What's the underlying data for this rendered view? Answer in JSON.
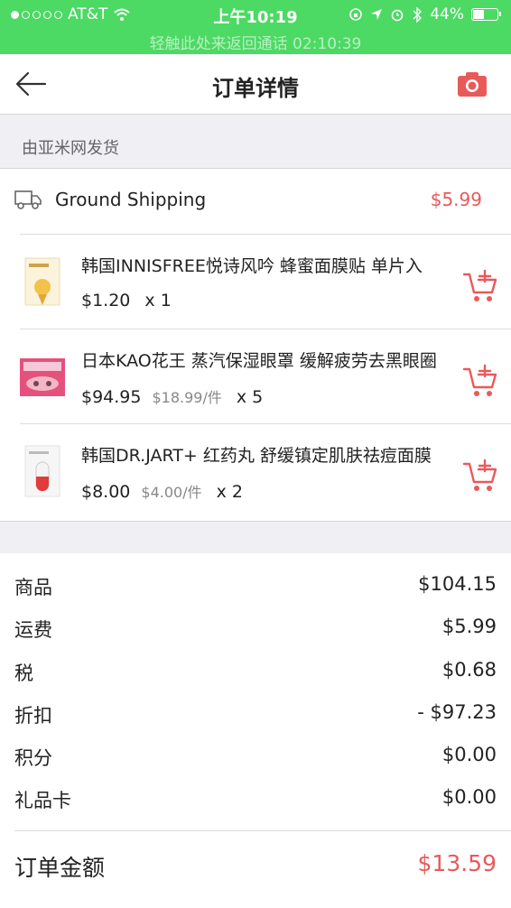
{
  "status_bar": {
    "carrier": "AT&T",
    "time": "上午10:19",
    "battery": "44%",
    "battery_level": 0.44,
    "callback": "轻触此处来返回通话 02:10:39"
  },
  "nav": {
    "title": "订单详情"
  },
  "shipper": "由亚米网发货",
  "shipping": {
    "method": "Ground Shipping",
    "price": "$5.99"
  },
  "items": [
    {
      "name": "韩国INNISFREE悦诗风吟 蜂蜜面膜贴 单片入",
      "price": "$1.20",
      "unit_price": "",
      "qty": "x 1"
    },
    {
      "name": "日本KAO花王 蒸汽保湿眼罩 缓解疲劳去黑眼圈",
      "price": "$94.95",
      "unit_price": "$18.99/件",
      "qty": "x 5"
    },
    {
      "name": "韩国DR.JART+ 红药丸 舒缓镇定肌肤祛痘面膜",
      "price": "$8.00",
      "unit_price": "$4.00/件",
      "qty": "x 2"
    }
  ],
  "summary": {
    "rows": [
      {
        "label": "商品",
        "value": "$104.15"
      },
      {
        "label": "运费",
        "value": "$5.99"
      },
      {
        "label": "税",
        "value": "$0.68"
      },
      {
        "label": "折扣",
        "value": "- $97.23"
      },
      {
        "label": "积分",
        "value": "$0.00"
      },
      {
        "label": "礼品卡",
        "value": "$0.00"
      }
    ],
    "total_label": "订单金额",
    "total_value": "$13.59"
  },
  "colors": {
    "status_bar": "#4cd964",
    "accent_red": "#e85a5a",
    "background": "#efeff4"
  }
}
